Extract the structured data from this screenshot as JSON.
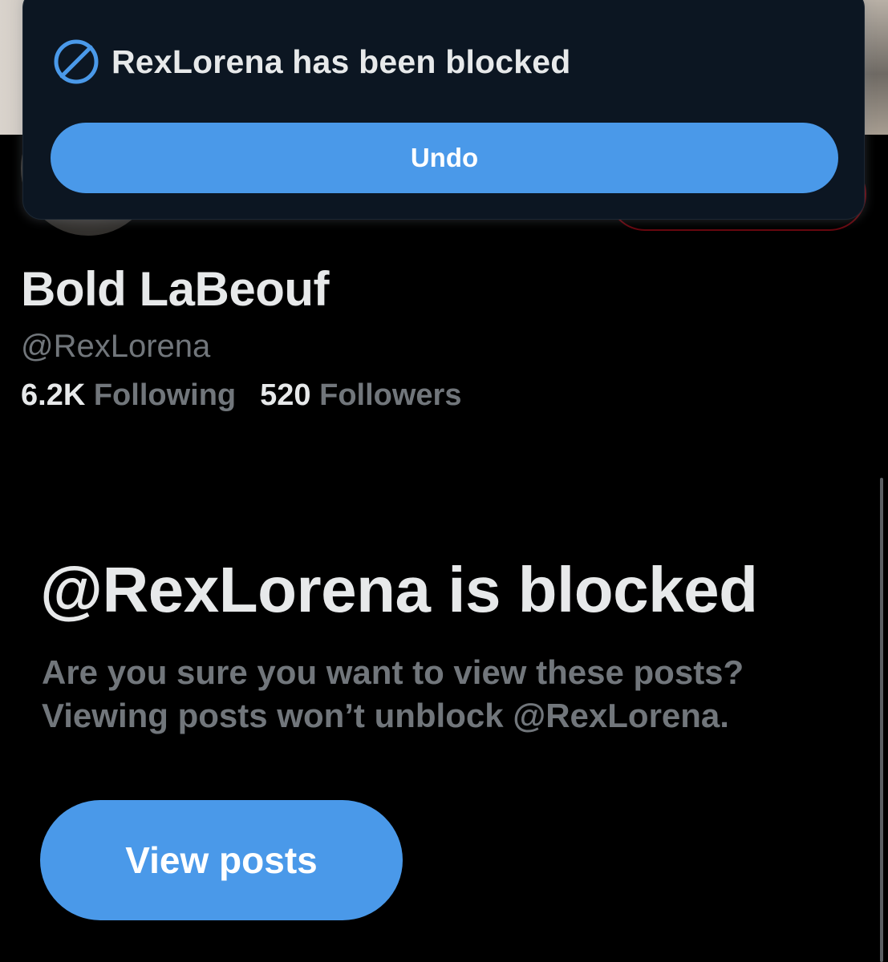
{
  "toast": {
    "icon": "block-icon",
    "message": "RexLorena has been blocked",
    "undo_label": "Undo"
  },
  "profile": {
    "display_name": "Bold LaBeouf",
    "handle": "@RexLorena",
    "following_count": "6.2K",
    "following_label": "Following",
    "followers_count": "520",
    "followers_label": "Followers"
  },
  "blocked_notice": {
    "title": "@RexLorena is blocked",
    "line1": "Are you sure you want to view these posts?",
    "line2": "Viewing posts won’t unblock @RexLorena.",
    "view_posts_label": "View posts"
  },
  "colors": {
    "accent": "#4a99e9",
    "background": "#000000",
    "toast_bg": "#0c1622",
    "muted_text": "#71767b",
    "primary_text": "#e7e9ea"
  }
}
